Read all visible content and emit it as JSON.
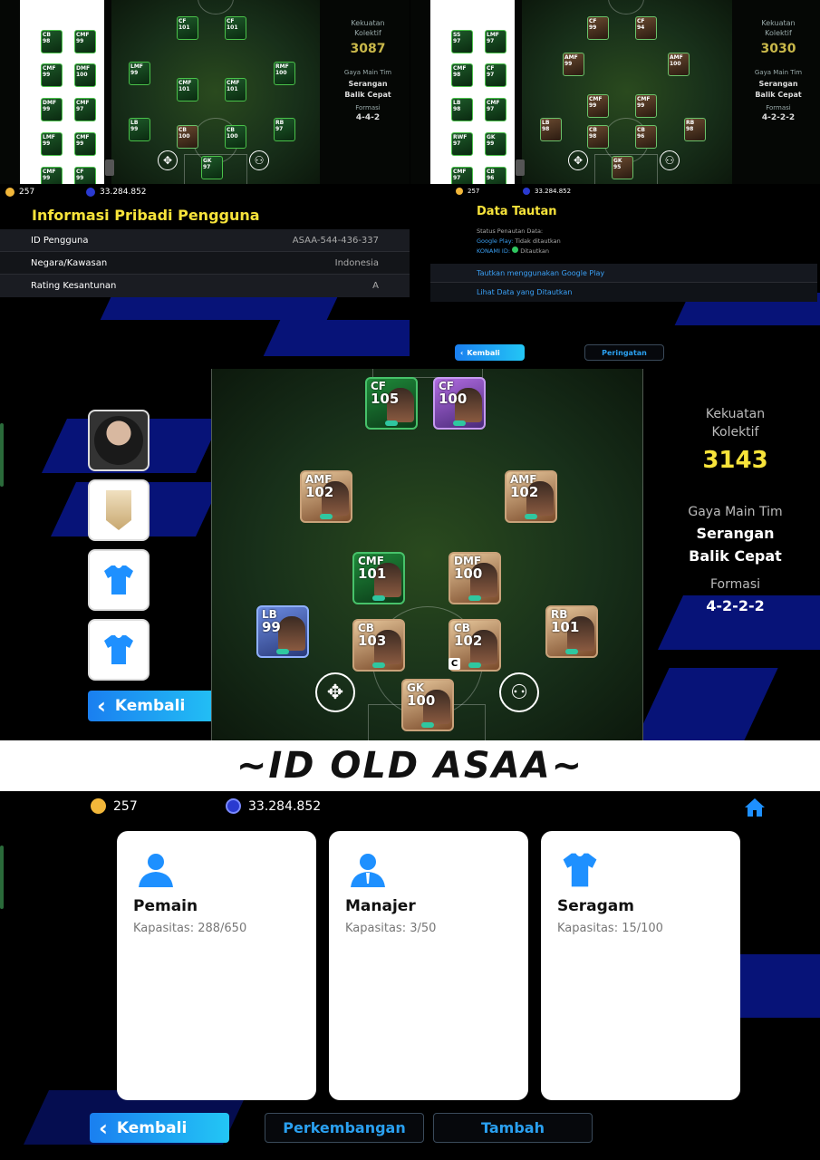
{
  "currency": {
    "coins": "257",
    "gp": "33.284.852"
  },
  "panel_a": {
    "strength_label": "Kekuatan Kolektif",
    "strength_value": "3087",
    "style_label": "Gaya Main Tim",
    "style_value": "Serangan Balik Cepat",
    "formation_label": "Formasi",
    "formation_value": "4-4-2",
    "side_cards": [
      [
        "CB",
        "98"
      ],
      [
        "CMF",
        "99"
      ],
      [
        "CMF",
        "99"
      ],
      [
        "DMF",
        "100"
      ],
      [
        "DMF",
        "99"
      ],
      [
        "CMF",
        "97"
      ],
      [
        "LMF",
        "99"
      ],
      [
        "CMF",
        "99"
      ],
      [
        "CMF",
        "99"
      ],
      [
        "CF",
        "99"
      ]
    ],
    "field_cards": [
      [
        "CF",
        "101"
      ],
      [
        "CF",
        "101"
      ],
      [
        "LMF",
        "99"
      ],
      [
        "CMF",
        "101"
      ],
      [
        "CMF",
        "101"
      ],
      [
        "RMF",
        "100"
      ],
      [
        "LB",
        "99"
      ],
      [
        "CB",
        "100"
      ],
      [
        "CB",
        "100"
      ],
      [
        "RB",
        "97"
      ],
      [
        "GK",
        "97"
      ]
    ]
  },
  "panel_b": {
    "strength_label": "Kekuatan Kolektif",
    "strength_value": "3030",
    "style_label": "Gaya Main Tim",
    "style_value": "Serangan Balik Cepat",
    "formation_label": "Formasi",
    "formation_value": "4-2-2-2",
    "side_cards": [
      [
        "SS",
        "97"
      ],
      [
        "LMF",
        "97"
      ],
      [
        "CMF",
        "98"
      ],
      [
        "CF",
        "97"
      ],
      [
        "LB",
        "98"
      ],
      [
        "CMF",
        "97"
      ],
      [
        "RWF",
        "97"
      ],
      [
        "GK",
        "99"
      ],
      [
        "CMF",
        "97"
      ],
      [
        "CB",
        "96"
      ]
    ],
    "field_cards": [
      [
        "CF",
        "99"
      ],
      [
        "CF",
        "94"
      ],
      [
        "AMF",
        "99"
      ],
      [
        "AMF",
        "100"
      ],
      [
        "CMF",
        "99"
      ],
      [
        "CMF",
        "99"
      ],
      [
        "LB",
        "98"
      ],
      [
        "CB",
        "98"
      ],
      [
        "CB",
        "96"
      ],
      [
        "RB",
        "98"
      ],
      [
        "GK",
        "95"
      ]
    ]
  },
  "user_info": {
    "title": "Informasi Pribadi Pengguna",
    "rows": [
      {
        "label": "ID Pengguna",
        "value": "ASAA-544-436-337"
      },
      {
        "label": "Negara/Kawasan",
        "value": "Indonesia"
      },
      {
        "label": "Rating Kesantunan",
        "value": "A"
      }
    ]
  },
  "link_data": {
    "title": "Data Tautan",
    "status_label": "Status Penautan Data:",
    "google_play_label": "Google Play:",
    "google_play_value": "Tidak ditautkan",
    "konami_label": "KONAMI ID:",
    "konami_value": "Ditautkan",
    "action_link_google": "Tautkan menggunakan Google Play",
    "action_view_linked": "Lihat Data yang Ditautkan",
    "back_label": "Kembali",
    "warning_label": "Peringatan"
  },
  "main_squad": {
    "strength_label1": "Kekuatan",
    "strength_label2": "Kolektif",
    "strength_value": "3143",
    "style_label": "Gaya Main Tim",
    "style_line1": "Serangan",
    "style_line2": "Balik Cepat",
    "formation_label": "Formasi",
    "formation_value": "4-2-2-2",
    "back_label": "Kembali",
    "captain_badge": "C",
    "cards": [
      {
        "pos": "CF",
        "ovr": "105"
      },
      {
        "pos": "CF",
        "ovr": "100"
      },
      {
        "pos": "AMF",
        "ovr": "102"
      },
      {
        "pos": "AMF",
        "ovr": "102"
      },
      {
        "pos": "CMF",
        "ovr": "101"
      },
      {
        "pos": "DMF",
        "ovr": "100"
      },
      {
        "pos": "LB",
        "ovr": "99"
      },
      {
        "pos": "CB",
        "ovr": "103"
      },
      {
        "pos": "CB",
        "ovr": "102"
      },
      {
        "pos": "RB",
        "ovr": "101"
      },
      {
        "pos": "GK",
        "ovr": "100"
      }
    ]
  },
  "banner": {
    "text": "~ID OLD ASAA~"
  },
  "contracts": {
    "cards": [
      {
        "title": "Pemain",
        "capacity": "Kapasitas: 288/650"
      },
      {
        "title": "Manajer",
        "capacity": "Kapasitas: 3/50"
      },
      {
        "title": "Seragam",
        "capacity": "Kapasitas: 15/100"
      }
    ],
    "back_label": "Kembali",
    "progress_label": "Perkembangan",
    "add_label": "Tambah"
  },
  "colors": {
    "accent_blue": "#1a7ff0",
    "gold": "#f7e33a",
    "stripe": "#0a1aa0"
  }
}
